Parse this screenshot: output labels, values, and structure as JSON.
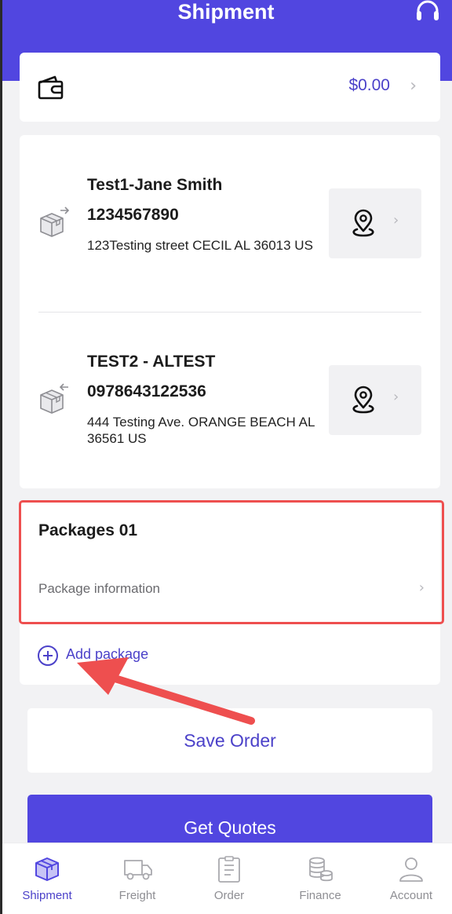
{
  "header": {
    "title": "Shipment",
    "support_icon": "headset-icon"
  },
  "wallet": {
    "icon": "wallet-icon",
    "balance": "$0.00"
  },
  "addresses": [
    {
      "role": "sender",
      "name": "Test1-Jane Smith",
      "phone": "1234567890",
      "address": "123Testing street CECIL AL 36013 US",
      "icon": "box-outgoing-icon"
    },
    {
      "role": "receiver",
      "name": "TEST2 - ALTEST",
      "phone": "0978643122536",
      "address": "444 Testing Ave. ORANGE BEACH AL 36561 US",
      "icon": "box-incoming-icon"
    }
  ],
  "package": {
    "title": "Packages 01",
    "info_label": "Package information",
    "add_label": "Add package"
  },
  "actions": {
    "save": "Save Order",
    "quotes": "Get Quotes"
  },
  "tabs": [
    {
      "label": "Shipment",
      "icon": "box-icon",
      "active": true
    },
    {
      "label": "Freight",
      "icon": "truck-icon",
      "active": false
    },
    {
      "label": "Order",
      "icon": "clipboard-icon",
      "active": false
    },
    {
      "label": "Finance",
      "icon": "coins-icon",
      "active": false
    },
    {
      "label": "Account",
      "icon": "user-icon",
      "active": false
    }
  ],
  "colors": {
    "brand": "#5146e0",
    "accent_text": "#4b41c9",
    "highlight": "#ee4f4f"
  }
}
